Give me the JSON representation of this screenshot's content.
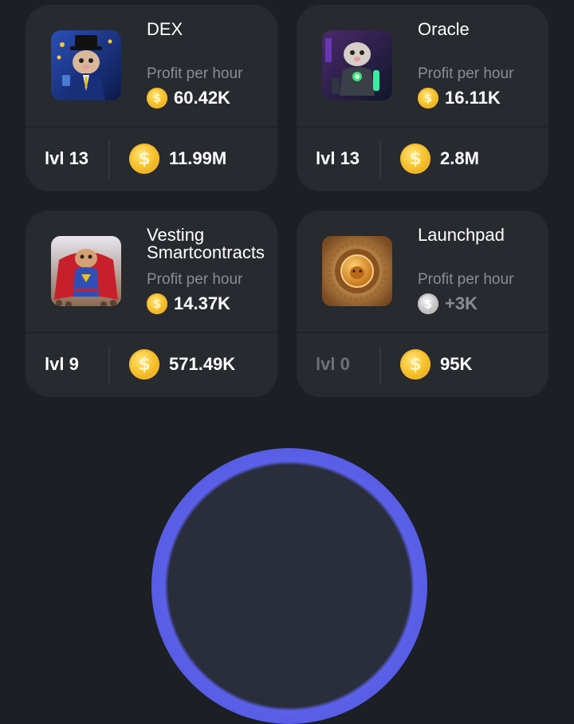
{
  "cards": [
    {
      "name": "DEX",
      "profit_label": "Profit per hour",
      "profit_value": "60.42K",
      "level": "lvl 13",
      "cost": "11.99M",
      "thumb_icon": "hamster-tycoon-icon",
      "locked": false
    },
    {
      "name": "Oracle",
      "profit_label": "Profit per hour",
      "profit_value": "16.11K",
      "level": "lvl 13",
      "cost": "2.8M",
      "thumb_icon": "hamster-robot-icon",
      "locked": false
    },
    {
      "name": "Vesting Smartcontracts",
      "profit_label": "Profit per hour",
      "profit_value": "14.37K",
      "level": "lvl 9",
      "cost": "571.49K",
      "thumb_icon": "hamster-superhero-icon",
      "locked": false
    },
    {
      "name": "Launchpad",
      "profit_label": "Profit per hour",
      "profit_value": "+3K",
      "level": "lvl 0",
      "cost": "95K",
      "thumb_icon": "launchpad-medallion-icon",
      "locked": true
    }
  ],
  "colors": {
    "background": "#1c1f24",
    "card": "#272a2f",
    "accent_ring": "#5a60e8",
    "coin_gold": "#f7c531"
  }
}
